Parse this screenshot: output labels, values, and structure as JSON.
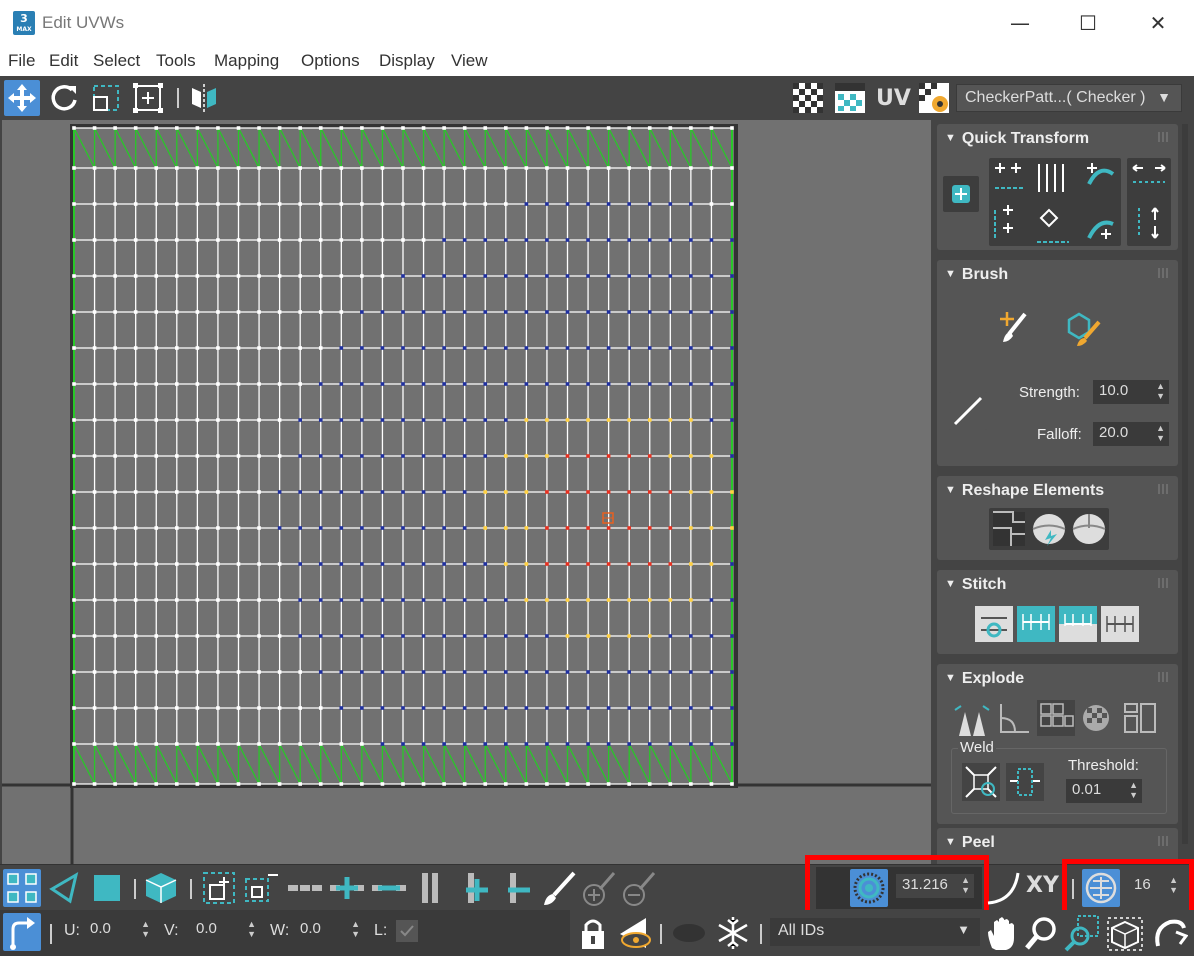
{
  "window": {
    "title": "Edit UVWs",
    "app_icon": {
      "number": "3",
      "text": "MAX"
    },
    "minimize": "—",
    "maximize": "☐",
    "close": "✕"
  },
  "menu": [
    "File",
    "Edit",
    "Select",
    "Tools",
    "Mapping",
    "Options",
    "Display",
    "View"
  ],
  "toolbar": {
    "uv_label": "UV",
    "texture_dropdown": "CheckerPatt...( Checker )"
  },
  "panel": {
    "quick_transform": "Quick Transform",
    "brush": "Brush",
    "strength_label": "Strength:",
    "strength_value": "10.0",
    "falloff_label": "Falloff:",
    "falloff_value": "20.0",
    "reshape": "Reshape Elements",
    "stitch": "Stitch",
    "explode": "Explode",
    "weld": "Weld",
    "threshold_label": "Threshold:",
    "threshold_value": "0.01",
    "peel": "Peel"
  },
  "bottom1": {
    "soft_value": "31.216",
    "xy_label": "XY",
    "grid_value": "16"
  },
  "bottom2": {
    "u_label": "U:",
    "u_value": "0.0",
    "v_label": "V:",
    "v_value": "0.0",
    "w_label": "W:",
    "w_value": "0.0",
    "l_label": "L:",
    "ids_dropdown": "All IDs"
  },
  "colors": {
    "accent": "#3fb8c2",
    "selection_blue": "#4b8fd6",
    "highlight": "#ff0000",
    "seam": "#28c828"
  }
}
